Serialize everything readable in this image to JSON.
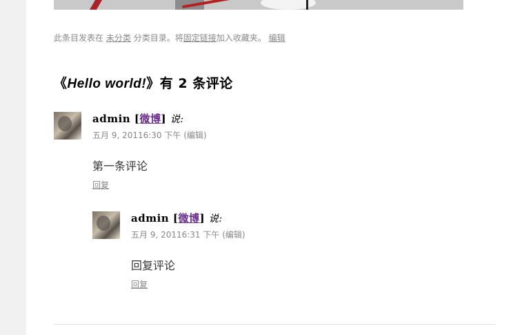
{
  "entry_meta": {
    "prefix": "此条目发表在",
    "category": "未分类",
    "mid": "分类目录。将",
    "permalink": "固定链接",
    "suffix": "加入收藏夹。",
    "edit": "编辑"
  },
  "comments_title": {
    "open": "《",
    "post_title": "Hello world!",
    "close": "》有 2 条评论"
  },
  "comments": [
    {
      "author": "admin",
      "bracket_open": "[",
      "weibo": "微博",
      "bracket_close": "]",
      "says": "说:",
      "date": "五月 9, 20116:30 下午",
      "edit": "(编辑)",
      "text": "第一条评论",
      "reply": "回复"
    },
    {
      "author": "admin",
      "bracket_open": "[",
      "weibo": "微博",
      "bracket_close": "]",
      "says": "说:",
      "date": "五月 9, 20116:31 下午",
      "edit": "(编辑)",
      "text": "回复评论",
      "reply": "回复"
    }
  ],
  "colors": {
    "link_visited": "#6b2c8f",
    "meta_gray": "#888888",
    "page_bg": "#ffffff",
    "gutter_bg": "#f1f1f1"
  }
}
